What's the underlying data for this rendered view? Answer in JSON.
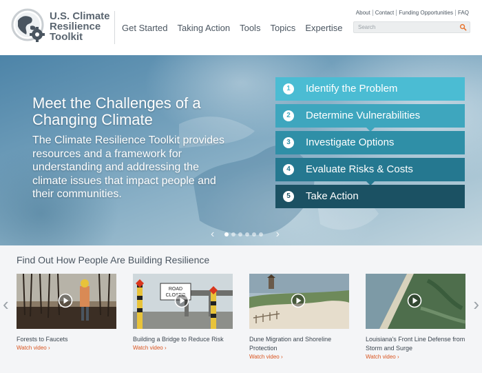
{
  "header": {
    "logo": {
      "line1": "U.S. Climate",
      "line2": "Resilience",
      "line3": "Toolkit"
    },
    "nav": [
      "Get Started",
      "Taking Action",
      "Tools",
      "Topics",
      "Expertise"
    ],
    "utility": [
      "About",
      "Contact",
      "Funding Opportunities",
      "FAQ"
    ],
    "search": {
      "placeholder": "Search"
    }
  },
  "hero": {
    "title": "Meet the Challenges of a Changing Climate",
    "description": "The Climate Resilience Toolkit provides resources and a framework for understanding and addressing the climate issues that impact people and their communities.",
    "steps": [
      {
        "num": "1",
        "label": "Identify the Problem",
        "color": "#4bbcd3"
      },
      {
        "num": "2",
        "label": "Determine Vulnerabilities",
        "color": "#3ea6be"
      },
      {
        "num": "3",
        "label": "Investigate Options",
        "color": "#2f8fa7"
      },
      {
        "num": "4",
        "label": "Evaluate Risks & Costs",
        "color": "#257890"
      },
      {
        "num": "5",
        "label": "Take Action",
        "color": "#1b5163"
      }
    ],
    "carousel": {
      "prev": "‹",
      "next": "›",
      "dots": 6,
      "active": 0
    }
  },
  "stories": {
    "heading": "Find Out How People Are Building Resilience",
    "link_label": "Watch video ›",
    "prev": "‹",
    "next": "›",
    "items": [
      {
        "title": "Forests to Faucets",
        "icon": "forest-photo"
      },
      {
        "title": "Building a Bridge to Reduce Risk",
        "icon": "bridge-photo",
        "sign1": "ROAD",
        "sign2": "CLOSED"
      },
      {
        "title": "Dune Migration and Shoreline Protection",
        "icon": "dune-photo"
      },
      {
        "title": "Louisiana's Front Line Defense from Storm and Surge",
        "icon": "coast-photo"
      }
    ]
  },
  "colors": {
    "accent": "#d9531e",
    "text": "#4a5560"
  }
}
